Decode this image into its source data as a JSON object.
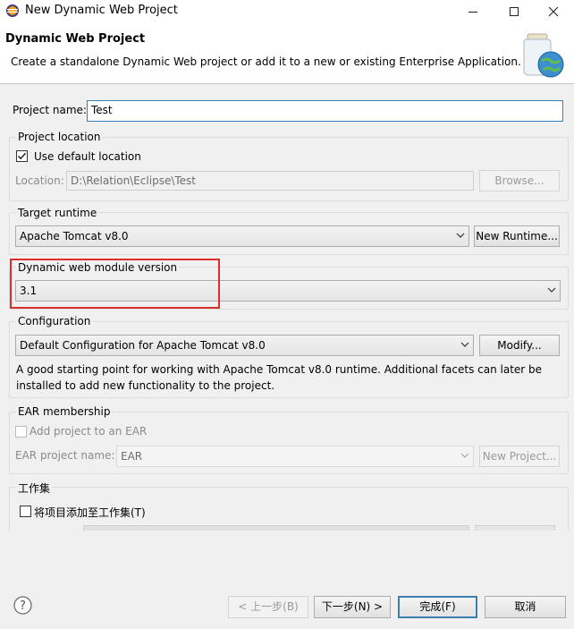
{
  "window": {
    "title": "New Dynamic Web Project",
    "minimize_icon": "minimize-icon",
    "maximize_icon": "maximize-icon",
    "close_icon": "close-icon"
  },
  "header": {
    "title": "Dynamic Web Project",
    "description": "Create a standalone Dynamic Web project or add it to a new or existing Enterprise Application.",
    "icon": "web-project-jar-globe-icon"
  },
  "project_name": {
    "label": "Project name:",
    "value": "Test"
  },
  "project_location": {
    "group_label": "Project location",
    "use_default_label": "Use default location",
    "use_default_checked": true,
    "location_label": "Location:",
    "location_value": "D:\\Relation\\Eclipse\\Test",
    "browse_label": "Browse..."
  },
  "target_runtime": {
    "group_label": "Target runtime",
    "selected": "Apache Tomcat v8.0",
    "new_runtime_label": "New Runtime..."
  },
  "module_version": {
    "group_label": "Dynamic web module version",
    "selected": "3.1"
  },
  "configuration": {
    "group_label": "Configuration",
    "selected": "Default Configuration for Apache Tomcat v8.0",
    "modify_label": "Modify...",
    "description_line1": "A good starting point for working with Apache Tomcat v8.0 runtime. Additional facets can later be",
    "description_line2": "installed to add new functionality to the project."
  },
  "ear_membership": {
    "group_label": "EAR membership",
    "add_label": "Add project to an EAR",
    "add_checked": false,
    "ear_name_label": "EAR project name:",
    "ear_name_value": "EAR",
    "new_project_label": "New Project..."
  },
  "working_sets": {
    "group_label": "工作集",
    "add_label": "将项目添加至工作集(T)",
    "add_checked": false
  },
  "footer": {
    "help_icon": "help-icon",
    "back_label": "< 上一步(B)",
    "next_label": "下一步(N) >",
    "finish_label": "完成(F)",
    "cancel_label": "取消"
  },
  "colors": {
    "highlight": "#d9302b",
    "focus_border": "#3c7fb1"
  }
}
